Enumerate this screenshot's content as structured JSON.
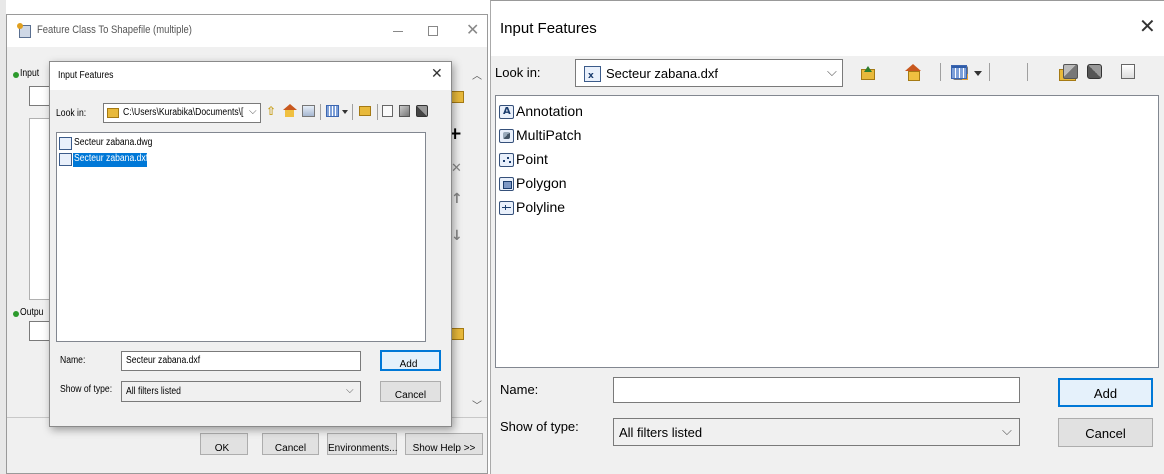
{
  "left": {
    "tool_window": {
      "title": "Feature Class To Shapefile (multiple)",
      "input_label": "Input",
      "output_label": "Outpu",
      "ok_label": "OK",
      "cancel_label": "Cancel",
      "environments_label": "Environments...",
      "show_help_label": "Show Help >>"
    },
    "dialog": {
      "title": "Input Features",
      "look_in_label": "Look in:",
      "look_in_value": "C:\\Users\\Kurabika\\Documents\\[",
      "files": [
        {
          "name": "Secteur zabana.dwg",
          "selected": false
        },
        {
          "name": "Secteur zabana.dxf",
          "selected": true
        }
      ],
      "name_label": "Name:",
      "name_value": "Secteur zabana.dxf",
      "type_label": "Show of type:",
      "type_value": "All filters listed",
      "add_label": "Add",
      "cancel_label": "Cancel"
    }
  },
  "right": {
    "title": "Input Features",
    "look_in_label": "Look in:",
    "look_in_value": "Secteur zabana.dxf",
    "items": [
      {
        "label": "Annotation",
        "icon": "annotation-icon"
      },
      {
        "label": "MultiPatch",
        "icon": "multipatch-icon"
      },
      {
        "label": "Point",
        "icon": "point-icon"
      },
      {
        "label": "Polygon",
        "icon": "polygon-icon"
      },
      {
        "label": "Polyline",
        "icon": "polyline-icon"
      }
    ],
    "name_label": "Name:",
    "name_value": "",
    "type_label": "Show of type:",
    "type_value": "All filters listed",
    "add_label": "Add",
    "cancel_label": "Cancel"
  },
  "colors": {
    "selection": "#0078d7",
    "window_bg": "#f0f0f0",
    "accent_border": "#0078d7"
  }
}
